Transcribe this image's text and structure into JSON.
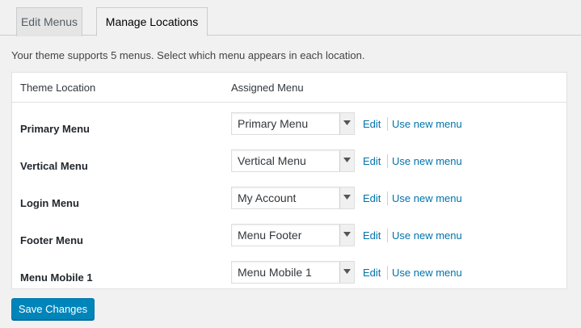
{
  "tabs": [
    {
      "label": "Edit Menus"
    },
    {
      "label": "Manage Locations"
    }
  ],
  "intro": "Your theme supports 5 menus. Select which menu appears in each location.",
  "table": {
    "col_location": "Theme Location",
    "col_menu": "Assigned Menu",
    "rows": [
      {
        "location": "Primary Menu",
        "menu": "Primary Menu",
        "edit": "Edit",
        "new": "Use new menu"
      },
      {
        "location": "Vertical Menu",
        "menu": "Vertical Menu",
        "edit": "Edit",
        "new": "Use new menu"
      },
      {
        "location": "Login Menu",
        "menu": "My Account",
        "edit": "Edit",
        "new": "Use new menu"
      },
      {
        "location": "Footer Menu",
        "menu": "Menu Footer",
        "edit": "Edit",
        "new": "Use new menu"
      },
      {
        "location": "Menu Mobile 1",
        "menu": "Menu Mobile 1",
        "edit": "Edit",
        "new": "Use new menu"
      }
    ]
  },
  "save_label": "Save Changes",
  "colors": {
    "link": "#0073aa",
    "button": "#0085ba"
  }
}
